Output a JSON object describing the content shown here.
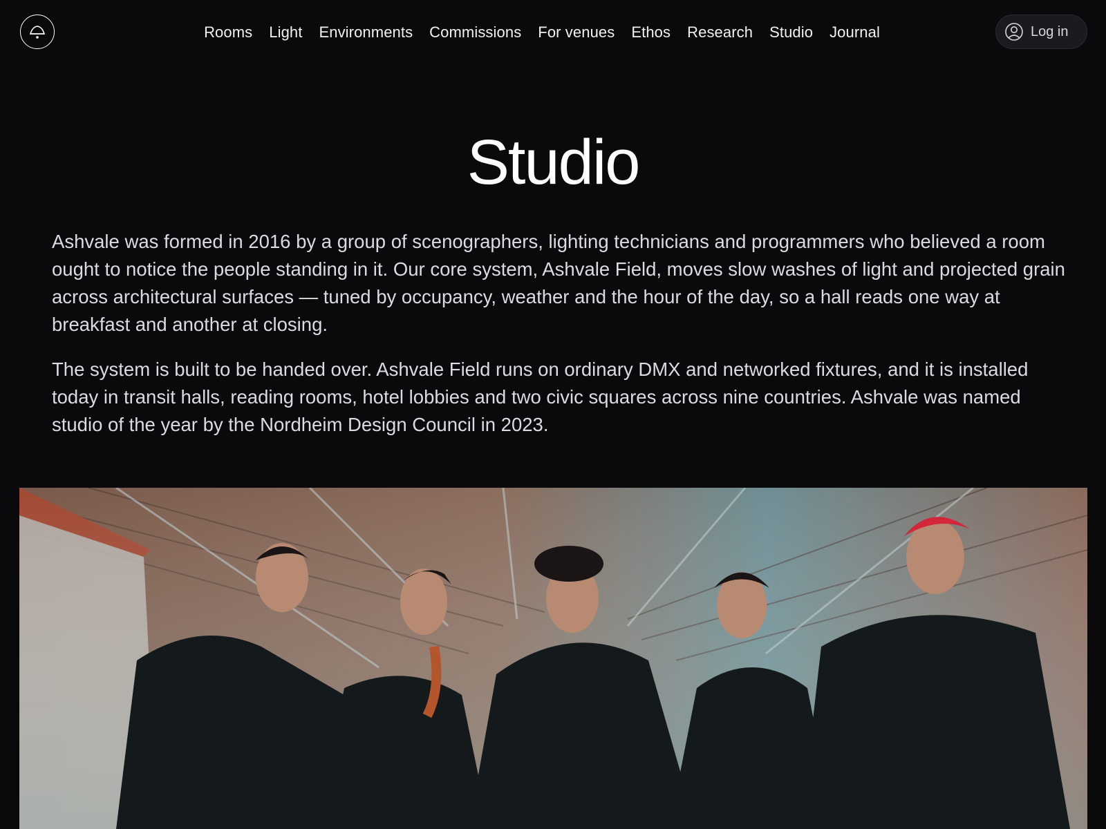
{
  "header": {
    "logo_icon": "bell-icon",
    "nav": [
      {
        "label": "Rooms"
      },
      {
        "label": "Light"
      },
      {
        "label": "Environments"
      },
      {
        "label": "Commissions"
      },
      {
        "label": "For venues"
      },
      {
        "label": "Ethos"
      },
      {
        "label": "Research"
      },
      {
        "label": "Studio"
      },
      {
        "label": "Journal"
      }
    ],
    "login": {
      "label": "Log in",
      "icon": "user-circle-icon"
    }
  },
  "main": {
    "title": "Studio",
    "paragraphs": [
      "Ashvale was formed in 2016 by a group of scenographers, lighting technicians and programmers who believed a room ought to notice the people standing in it. Our core system, Ashvale Field, moves slow washes of light and projected grain across architectural surfaces — tuned by occupancy, weather and the hour of the day, so a hall reads one way at breakfast and another at closing.",
      "The system is built to be handed over. Ashvale Field runs on ordinary DMX and networked fixtures, and it is installed today in transit halls, reading rooms, hotel lobbies and two civic squares across nine countries. Ashvale was named studio of the year by the Nordheim Design Council in 2023."
    ]
  },
  "colors": {
    "background": "#0a0a0d",
    "text": "#ffffff",
    "body_text": "#dcdce0",
    "login_bg": "#1a1b1f"
  }
}
